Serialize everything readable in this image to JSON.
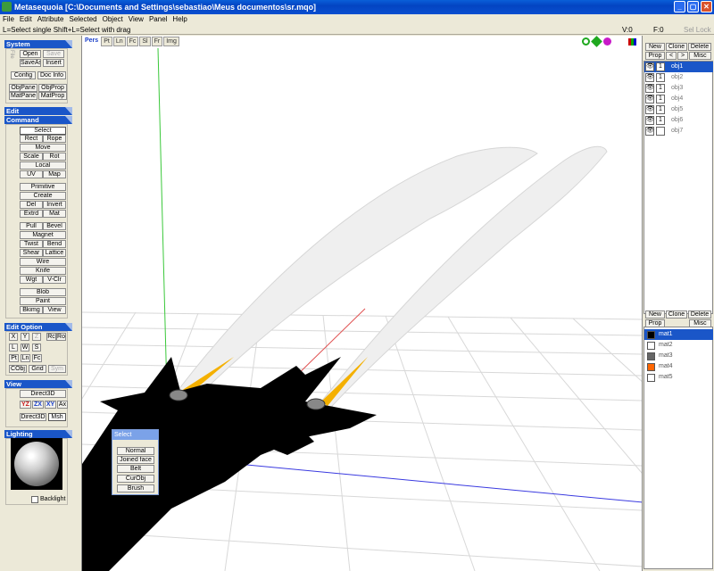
{
  "window": {
    "title": "Metasequoia [C:\\Documents and Settings\\sebastiao\\Meus documentos\\sr.mqo]",
    "buttons": [
      "_",
      "▢",
      "✕"
    ]
  },
  "menu": [
    "File",
    "Edit",
    "Attribute",
    "Selected",
    "Object",
    "View",
    "Panel",
    "Help"
  ],
  "status": {
    "hint": "L=Select single  Shift+L=Select with drag",
    "v": "V:0",
    "f": "F:0",
    "sellock": "Sel Lock"
  },
  "system": {
    "title": "System",
    "vlabel": "File",
    "open": "Open",
    "save": "Save",
    "saveas": "SaveAs",
    "insert": "Insert",
    "config": "Config",
    "docinfo": "Doc Info",
    "objpane": "ObjPane",
    "objprop": "ObjProp",
    "matpane": "MatPane",
    "matprop": "MatProp"
  },
  "edit": {
    "title": "Edit"
  },
  "command": {
    "title": "Command",
    "select": "Select",
    "rect": "Rect",
    "rope": "Rope",
    "move": "Move",
    "scale": "Scale",
    "rot": "Rot",
    "local": "Local",
    "uv": "UV",
    "map": "Map",
    "primitive": "Primitive",
    "create": "Create",
    "del": "Del",
    "invert": "Invert",
    "extrd": "Extrd",
    "mat": "Mat",
    "pull": "Pull",
    "bevel": "Bevel",
    "magnet": "Magnet",
    "twist": "Twist",
    "bend": "Bend",
    "shear": "Shear",
    "lattice": "Lattice",
    "wire": "Wire",
    "knife": "Knife",
    "wgt": "Wgt",
    "vclr": "V-Clr",
    "blob": "Blob",
    "paint": "Paint",
    "bkimg": "Bkimg",
    "view": "View"
  },
  "editoption": {
    "title": "Edit Option",
    "x": "X",
    "y": "Y",
    "z": "Z",
    "rc": "Rc",
    "ro": "Ro",
    "l": "L",
    "w": "W",
    "s": "S",
    "pt": "Pt",
    "ln": "Ln",
    "fc": "Fc",
    "cobj": "CObj",
    "grid": "Grid",
    "sym": "Sym"
  },
  "viewsec": {
    "title": "View",
    "direct3d": "Direct3D",
    "yz": "YZ",
    "zx": "ZX",
    "xy": "XY",
    "ax": "Ax",
    "direct3d2": "Direct3D",
    "msh": "Msh"
  },
  "lighting": {
    "title": "Lighting",
    "backlight": "Backlight"
  },
  "viewport": {
    "tabs": [
      "Pers",
      "Pt",
      "Ln",
      "Fc",
      "Sl",
      "Fr",
      "Img"
    ]
  },
  "objpanel": {
    "new": "New",
    "clone": "Clone",
    "delete": "Delete",
    "prop": "Prop",
    "left": "<",
    "right": ">",
    "misc": "Misc",
    "objects": [
      "obj1",
      "obj2",
      "obj3",
      "obj4",
      "obj5",
      "obj6",
      "obj7"
    ]
  },
  "matpanel": {
    "new": "New",
    "clone": "Clone",
    "delete": "Delete",
    "prop": "Prop",
    "misc": "Misc",
    "materials": [
      {
        "name": "mat1",
        "color": "#000000"
      },
      {
        "name": "mat2",
        "color": "#ffffff"
      },
      {
        "name": "mat3",
        "color": "#666666"
      },
      {
        "name": "mat4",
        "color": "#ff6600"
      },
      {
        "name": "mat5",
        "color": "#ffffff"
      }
    ]
  },
  "selectwin": {
    "title": "Select",
    "items": [
      "Normal",
      "Joined face",
      "Belt",
      "CurObj",
      "Brush"
    ]
  }
}
